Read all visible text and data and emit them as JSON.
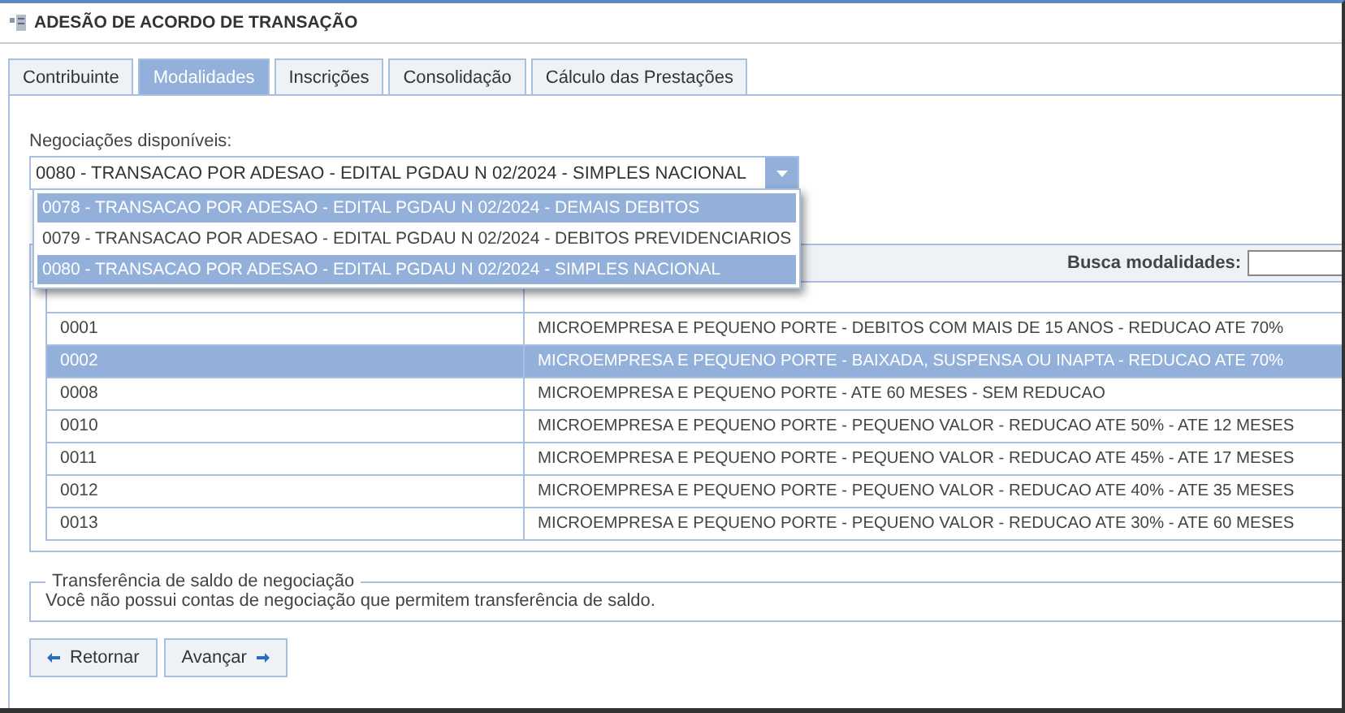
{
  "window": {
    "title": "ADESÃO DE ACORDO DE TRANSAÇÃO"
  },
  "tabs": [
    {
      "label": "Contribuinte",
      "selected": false
    },
    {
      "label": "Modalidades",
      "selected": true
    },
    {
      "label": "Inscrições",
      "selected": false
    },
    {
      "label": "Consolidação",
      "selected": false
    },
    {
      "label": "Cálculo das Prestações",
      "selected": false
    }
  ],
  "negotiations": {
    "label": "Negociações disponíveis:",
    "value": "0080 - TRANSACAO POR ADESAO - EDITAL PGDAU N 02/2024 - SIMPLES NACIONAL",
    "options": [
      {
        "label": "0078 - TRANSACAO POR ADESAO - EDITAL PGDAU N 02/2024 - DEMAIS DEBITOS",
        "selected": true
      },
      {
        "label": "0079 - TRANSACAO POR ADESAO - EDITAL PGDAU N 02/2024 - DEBITOS PREVIDENCIARIOS",
        "selected": false
      },
      {
        "label": "0080 - TRANSACAO POR ADESAO - EDITAL PGDAU N 02/2024 - SIMPLES NACIONAL",
        "selected": true
      }
    ]
  },
  "search": {
    "label": "Busca modalidades:"
  },
  "table": {
    "rows": [
      {
        "code": "0001",
        "description": "MICROEMPRESA E PEQUENO PORTE - DEBITOS COM MAIS DE 15 ANOS - REDUCAO ATE 70%",
        "selected": false
      },
      {
        "code": "0002",
        "description": "MICROEMPRESA E PEQUENO PORTE - BAIXADA, SUSPENSA OU INAPTA - REDUCAO ATE 70%",
        "selected": true
      },
      {
        "code": "0008",
        "description": "MICROEMPRESA E PEQUENO PORTE - ATE 60 MESES - SEM REDUCAO",
        "selected": false
      },
      {
        "code": "0010",
        "description": "MICROEMPRESA E PEQUENO PORTE - PEQUENO VALOR - REDUCAO ATE 50% - ATE 12 MESES",
        "selected": false
      },
      {
        "code": "0011",
        "description": "MICROEMPRESA E PEQUENO PORTE - PEQUENO VALOR - REDUCAO ATE 45% - ATE 17 MESES",
        "selected": false
      },
      {
        "code": "0012",
        "description": "MICROEMPRESA E PEQUENO PORTE - PEQUENO VALOR - REDUCAO ATE 40% - ATE 35 MESES",
        "selected": false
      },
      {
        "code": "0013",
        "description": "MICROEMPRESA E PEQUENO PORTE - PEQUENO VALOR - REDUCAO ATE 30% - ATE 60 MESES",
        "selected": false
      }
    ]
  },
  "transfer": {
    "legend": "Transferência de saldo de negociação",
    "message": "Você não possui contas de negociação que permitem transferência de saldo."
  },
  "buttons": [
    {
      "label": "Retornar",
      "kind": "back"
    },
    {
      "label": "Avançar",
      "kind": "next"
    }
  ]
}
